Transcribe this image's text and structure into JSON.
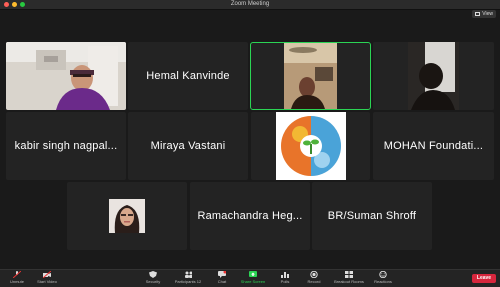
{
  "window": {
    "title": "Zoom Meeting",
    "view_label": "View"
  },
  "participants": {
    "hemal": "Hemal Kanvinde",
    "kabir": "kabir singh nagpal...",
    "miraya": "Miraya Vastani",
    "mohan": "MOHAN Foundati...",
    "ramachandra": "Ramachandra Heg...",
    "suman": "BR/Suman Shroff"
  },
  "toolbar": {
    "unmute": "Unmute",
    "start_video": "Start Video",
    "security": "Security",
    "participants": "Participants",
    "participants_count": "12",
    "chat": "Chat",
    "share_screen": "Share Screen",
    "polls": "Polls",
    "record": "Record",
    "breakout_rooms": "Breakout Rooms",
    "reactions": "Reactions",
    "leave": "Leave"
  },
  "colors": {
    "accent_green": "#2bd454",
    "leave_red": "#d7263d"
  }
}
